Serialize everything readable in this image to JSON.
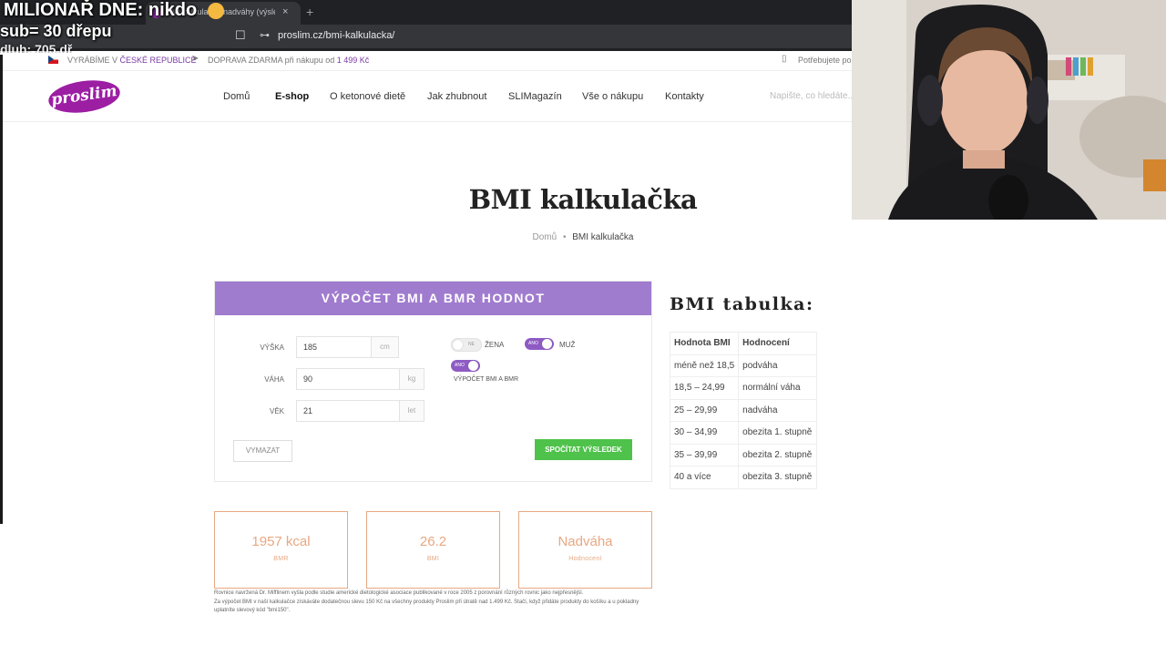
{
  "browser": {
    "tab_title": "BMI kalkulačka nadváhy (výsle",
    "tab_close": "×",
    "new_tab": "+",
    "url": "proslim.cz/bmi-kalkulacka/"
  },
  "overlay": {
    "line1": "MILIONAŘ DNE: nikdo",
    "line2": "sub= 30 dřepu",
    "line3": "dluh: 705 dř"
  },
  "infobar": {
    "made_prefix": "VYRÁBÍME V",
    "made_country": "ČESKÉ REPUBLICE",
    "shipping_prefix": "DOPRAVA ZDARMA při nákupu od",
    "shipping_amount": "1 499 Kč",
    "help": "Potřebujete po"
  },
  "nav": {
    "logo": "proslim",
    "items": [
      "Domů",
      "E-shop",
      "O ketonové dietě",
      "Jak zhubnout",
      "SLIMagazín",
      "Vše o nákupu",
      "Kontakty"
    ],
    "search_placeholder": "Napište, co hledáte..."
  },
  "page": {
    "title": "BMI kalkulačka",
    "breadcrumb_home": "Domů",
    "breadcrumb_sep": "•",
    "breadcrumb_current": "BMI kalkulačka"
  },
  "calculator": {
    "heading": "VÝPOČET BMI A BMR HODNOT",
    "height_label": "VÝŠKA",
    "height_value": "185",
    "height_unit": "cm",
    "weight_label": "VÁHA",
    "weight_value": "90",
    "weight_unit": "kg",
    "age_label": "VĚK",
    "age_value": "21",
    "age_unit": "let",
    "toggle_female_label": "ŽENA",
    "toggle_female_text": "NE",
    "toggle_male_label": "MUŽ",
    "toggle_male_text": "ANO",
    "toggle_bmr_label": "VÝPOČET BMI A BMR",
    "toggle_bmr_text": "ANO",
    "clear_button": "VYMAZAT",
    "calc_button": "SPOČÍTAT VÝSLEDEK"
  },
  "results": [
    {
      "value": "1957 kcal",
      "label": "BMR"
    },
    {
      "value": "26.2",
      "label": "BMI"
    },
    {
      "value": "Nadváha",
      "label": "Hodnocení"
    }
  ],
  "note": {
    "line1": "Rovnice navržená Dr. Mifflinem vyšla podle studie americké dietologické asociace publikované v roce 2005 z porovnání různých rovnic jako nejpřesnější.",
    "line2": "Za výpočet BMI v naší kalkulačce získáváte dodatečnou slevu 150 Kč na všechny produkty Proslim při útratě nad 1.499 Kč. Stačí, když přidáte produkty do košíku a u pokladny uplatníte slevový kód \"bmi150\"."
  },
  "bmi_table": {
    "title": "BMI tabulka:",
    "headers": [
      "Hodnota BMI",
      "Hodnocení"
    ],
    "rows": [
      [
        "méně než 18,5",
        "podváha"
      ],
      [
        "18,5 – 24,99",
        "normální váha"
      ],
      [
        "25 – 29,99",
        "nadváha"
      ],
      [
        "30 – 34,99",
        "obezita 1. stupně"
      ],
      [
        "35 – 39,99",
        "obezita 2. stupně"
      ],
      [
        "40 a více",
        "obezita 3. stupně"
      ]
    ]
  },
  "colors": {
    "brand": "#9c1ea3",
    "calc_header": "#a07ccf",
    "calc_button": "#4ec24a",
    "result_accent": "#e8a882"
  }
}
